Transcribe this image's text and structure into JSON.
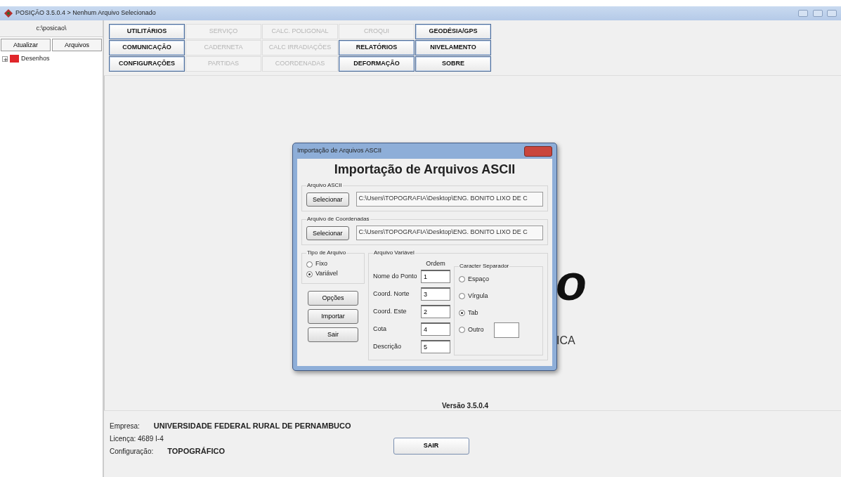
{
  "window": {
    "title": "POSIÇÃO 3.5.0.4 > Nenhum Arquivo Selecionado"
  },
  "sidebar": {
    "path": "c:\\posicao\\",
    "buttons": [
      "Atualizar",
      "Arquivos"
    ],
    "tree": [
      {
        "label": "Desenhos",
        "expanded": false
      }
    ]
  },
  "menu": [
    [
      {
        "label": "UTILITÁRIOS",
        "disabled": false
      },
      {
        "label": "SERVIÇO",
        "disabled": true
      },
      {
        "label": "CALC. POLIGONAL",
        "disabled": true
      },
      {
        "label": "CROQUI",
        "disabled": true
      },
      {
        "label": "GEODÉSIA/GPS",
        "disabled": false
      }
    ],
    [
      {
        "label": "COMUNICAÇÃO",
        "disabled": false
      },
      {
        "label": "CADERNETA",
        "disabled": true
      },
      {
        "label": "CALC IRRADIAÇÕES",
        "disabled": true
      },
      {
        "label": "RELATÓRIOS",
        "disabled": false
      },
      {
        "label": "NIVELAMENTO",
        "disabled": false
      }
    ],
    [
      {
        "label": "CONFIGURAÇÕES",
        "disabled": false
      },
      {
        "label": "PARTIDAS",
        "disabled": true
      },
      {
        "label": "COORDENADAS",
        "disabled": true
      },
      {
        "label": "DEFORMAÇÃO",
        "disabled": false
      },
      {
        "label": "SOBRE",
        "disabled": false
      }
    ]
  ],
  "background": {
    "logo_fragment": "o",
    "subtitle_fragment": "ICA",
    "version": "Versão 3.5.0.4"
  },
  "dialog": {
    "title": "Importação de Arquivos ASCII",
    "heading": "Importação de Arquivos ASCII",
    "files": [
      {
        "label": "Arquivo ASCII",
        "button": "Selecionar",
        "value": "C:\\Users\\TOPOGRAFIA\\Desktop\\ENG. BONITO LIXO DE C"
      },
      {
        "label": "Arquivo de Coordenadas",
        "button": "Selecionar",
        "value": "C:\\Users\\TOPOGRAFIA\\Desktop\\ENG. BONITO LIXO DE C"
      }
    ],
    "file_type": {
      "label": "Tipo de Arquivo",
      "options": [
        {
          "label": "Fixo",
          "selected": false
        },
        {
          "label": "Variável",
          "selected": true
        }
      ]
    },
    "buttons": [
      "Opções",
      "Importar",
      "Sair"
    ],
    "variable": {
      "label": "Arquivo Variável",
      "order_header": "Ordem",
      "fields": [
        {
          "label": "Nome do Ponto",
          "value": "1"
        },
        {
          "label": "Coord. Norte",
          "value": "3"
        },
        {
          "label": "Coord. Este",
          "value": "2"
        },
        {
          "label": "Cota",
          "value": "4"
        },
        {
          "label": "Descrição",
          "value": "5"
        }
      ]
    },
    "separator": {
      "label": "Caracter Separador",
      "options": [
        {
          "label": "Espaço",
          "selected": false,
          "kind": "plain"
        },
        {
          "label": "Vírgula",
          "selected": false,
          "kind": "plain"
        },
        {
          "label": "Tab",
          "selected": true,
          "kind": "plain"
        },
        {
          "label": "Outro",
          "selected": false,
          "kind": "field"
        }
      ]
    }
  },
  "footer": {
    "company_label": "Empresa:",
    "company": "UNIVERSIDADE FEDERAL RURAL DE PERNAMBUCO",
    "license": "Licença: 4689 I-4",
    "config_label": "Configuração:",
    "config": "TOPOGRÁFICO",
    "exit": "SAIR"
  }
}
